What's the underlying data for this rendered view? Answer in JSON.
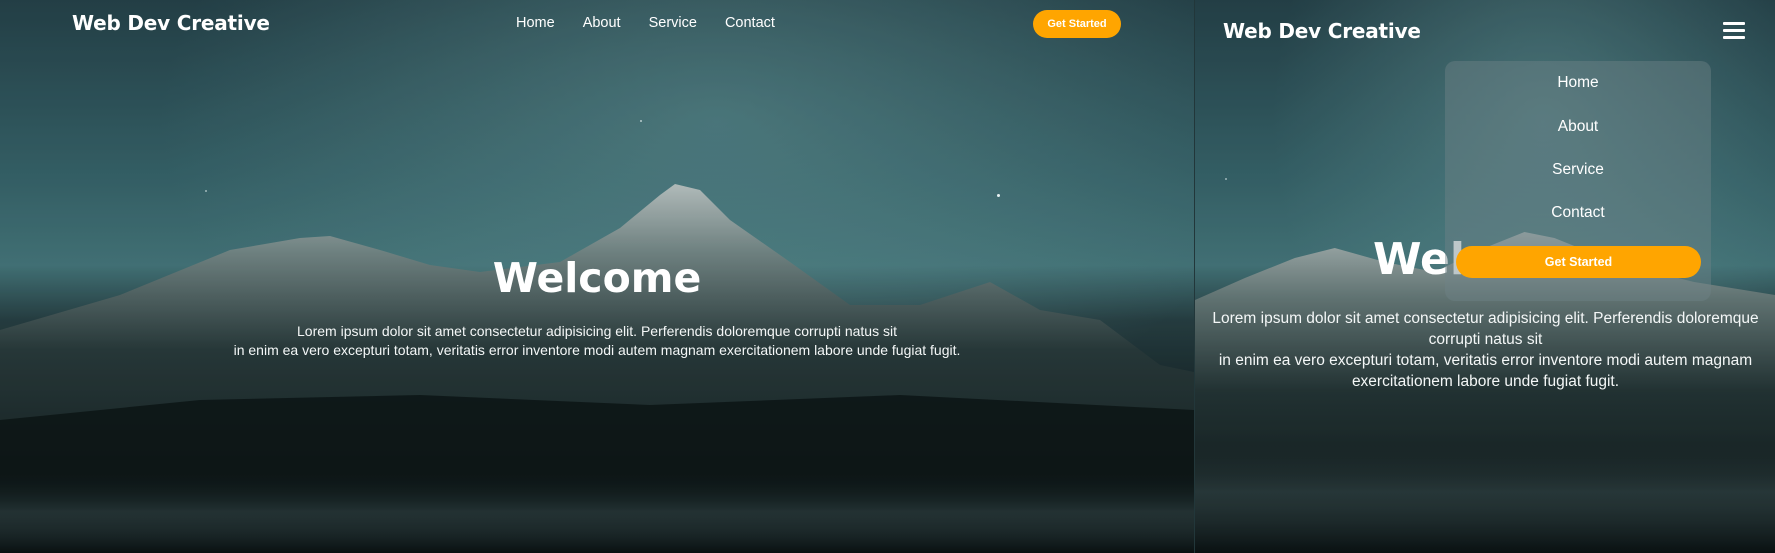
{
  "colors": {
    "accent": "#ffa500",
    "text": "#ffffff"
  },
  "desktop": {
    "brand": "Web Dev Creative",
    "nav": [
      "Home",
      "About",
      "Service",
      "Contact"
    ],
    "cta": "Get Started",
    "hero": {
      "title": "Welcome",
      "line1": "Lorem ipsum dolor sit amet consectetur adipisicing elit. Perferendis doloremque corrupti natus sit",
      "line2": "in enim ea vero excepturi totam, veritatis error inventore modi autem magnam exercitationem labore unde fugiat fugit."
    }
  },
  "mobile": {
    "brand": "Web Dev Creative",
    "menu_icon": "hamburger-icon",
    "menu": [
      "Home",
      "About",
      "Service",
      "Contact"
    ],
    "cta": "Get Started",
    "hero": {
      "title": "Welcome",
      "line1": "Lorem ipsum dolor sit amet consectetur adipisicing elit. Perferendis doloremque",
      "line2": "corrupti natus sit",
      "line3": "in enim ea vero excepturi totam, veritatis error inventore modi autem magnam",
      "line4": "exercitationem labore unde fugiat fugit."
    }
  }
}
